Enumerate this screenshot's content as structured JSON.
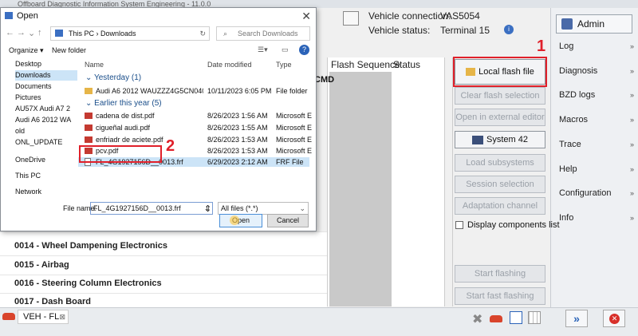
{
  "app": {
    "title": "Offboard Diagnostic Information System Engineering - 11.0.0"
  },
  "vehicle": {
    "connection_label": "Vehicle connection:",
    "connection_value": "VAS5054",
    "status_label": "Vehicle status:",
    "status_value": "Terminal 15"
  },
  "sidebar": {
    "admin": "Admin",
    "items": [
      "Log",
      "Diagnosis",
      "BZD logs",
      "Macros",
      "Trace",
      "Help",
      "Configuration",
      "Info"
    ]
  },
  "table": {
    "flash_sequence": "Flash Sequence",
    "status": "Status",
    "partial": "CMD"
  },
  "actions": {
    "local_flash": "Local flash file",
    "clear_selection": "Clear flash selection",
    "open_editor": "Open in external editor",
    "system42": "System 42",
    "load_subsystems": "Load subsystems",
    "session_selection": "Session selection",
    "adaptation": "Adaptation channel",
    "display_components": "Display components list",
    "start_flashing": "Start flashing",
    "start_fast": "Start fast flashing"
  },
  "modules": [
    "0014 - Wheel Dampening Electronics",
    "0015 - Airbag",
    "0016 - Steering Column Electronics",
    "0017 - Dash Board"
  ],
  "bottom": {
    "tab": "VEH - FL"
  },
  "dialog": {
    "title": "Open",
    "address": [
      "This PC",
      "Downloads"
    ],
    "search_placeholder": "Search Downloads",
    "organize": "Organize",
    "new_folder": "New folder",
    "nav": [
      "Desktop",
      "Downloads",
      "Documents",
      "Pictures",
      "AU57X Audi A7 2",
      "Audi A6 2012 WA",
      "old",
      "ONL_UPDATE",
      "OneDrive",
      "This PC",
      "Network"
    ],
    "cols": {
      "name": "Name",
      "date": "Date modified",
      "type": "Type"
    },
    "groups": {
      "yesterday": "Yesterday (1)",
      "earlier": "Earlier this year (5)"
    },
    "files": [
      {
        "name": "Audi A6 2012 WAUZZZ4G5CN040443 Fra...",
        "date": "10/11/2023 6:05 PM",
        "type": "File folder"
      },
      {
        "name": "cadena de dist.pdf",
        "date": "8/26/2023 1:56 AM",
        "type": "Microsoft Edge"
      },
      {
        "name": "cigueñal audi.pdf",
        "date": "8/26/2023 1:55 AM",
        "type": "Microsoft Edge"
      },
      {
        "name": "enfriadr de aciete.pdf",
        "date": "8/26/2023 1:53 AM",
        "type": "Microsoft Edge"
      },
      {
        "name": "pcv.pdf",
        "date": "8/26/2023 1:53 AM",
        "type": "Microsoft Edge"
      },
      {
        "name": "FL_4G1927156D__0013.frf",
        "date": "6/29/2023 2:12 AM",
        "type": "FRF File"
      }
    ],
    "filename_label": "File name:",
    "filename_value": "FL_4G1927156D__0013.frf",
    "filetype": "All files (*.*)",
    "open": "Open",
    "cancel": "Cancel"
  },
  "annotations": {
    "one": "1",
    "two": "2"
  },
  "colors": {
    "highlight": "#e0202a",
    "selection": "#cce4f7"
  }
}
